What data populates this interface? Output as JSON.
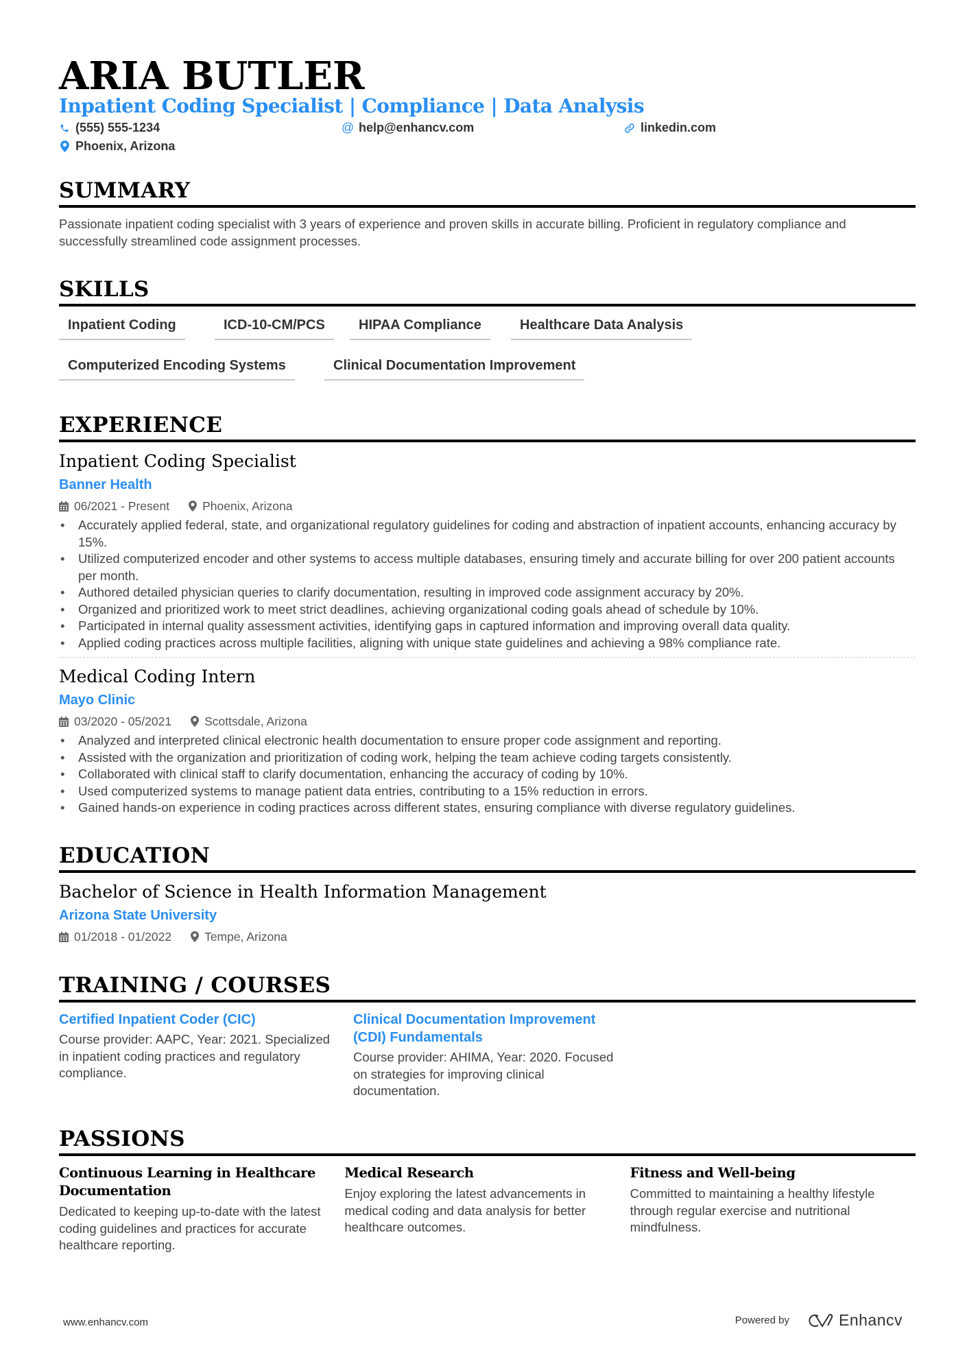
{
  "header": {
    "name": "ARIA BUTLER",
    "headline": "Inpatient Coding Specialist | Compliance | Data Analysis",
    "contacts": {
      "phone": {
        "icon": "phone-icon",
        "value": "(555) 555-1234"
      },
      "email": {
        "icon": "at-icon",
        "value": "help@enhancv.com"
      },
      "website": {
        "icon": "link-icon",
        "value": "linkedin.com"
      },
      "location": {
        "icon": "map-pin-icon",
        "value": "Phoenix, Arizona"
      }
    }
  },
  "summary": {
    "title": "SUMMARY",
    "text": "Passionate inpatient coding specialist with 3 years of experience and proven skills in accurate billing. Proficient in regulatory compliance and successfully streamlined code assignment processes."
  },
  "skills": {
    "title": "SKILLS",
    "items": [
      "Inpatient Coding",
      "ICD-10-CM/PCS",
      "HIPAA Compliance",
      "Healthcare Data Analysis",
      "Computerized Encoding Systems",
      "Clinical Documentation Improvement"
    ]
  },
  "experience": {
    "title": "EXPERIENCE",
    "items": [
      {
        "role": "Inpatient Coding Specialist",
        "company": "Banner Health",
        "dates": "06/2021 - Present",
        "location": "Phoenix, Arizona",
        "bullets": [
          "Accurately applied federal, state, and organizational regulatory guidelines for coding and abstraction of inpatient accounts, enhancing accuracy by 15%.",
          "Utilized computerized encoder and other systems to access multiple databases, ensuring timely and accurate billing for over 200 patient accounts per month.",
          "Authored detailed physician queries to clarify documentation, resulting in improved code assignment accuracy by 20%.",
          "Organized and prioritized work to meet strict deadlines, achieving organizational coding goals ahead of schedule by 10%.",
          "Participated in internal quality assessment activities, identifying gaps in captured information and improving overall data quality.",
          "Applied coding practices across multiple facilities, aligning with unique state guidelines and achieving a 98% compliance rate."
        ]
      },
      {
        "role": "Medical Coding Intern",
        "company": "Mayo Clinic",
        "dates": "03/2020 - 05/2021",
        "location": "Scottsdale, Arizona",
        "bullets": [
          "Analyzed and interpreted clinical electronic health documentation to ensure proper code assignment and reporting.",
          "Assisted with the organization and prioritization of coding work, helping the team achieve coding targets consistently.",
          "Collaborated with clinical staff to clarify documentation, enhancing the accuracy of coding by 10%.",
          "Used computerized systems to manage patient data entries, contributing to a 15% reduction in errors.",
          "Gained hands-on experience in coding practices across different states, ensuring compliance with diverse regulatory guidelines."
        ]
      }
    ]
  },
  "education": {
    "title": "EDUCATION",
    "items": [
      {
        "degree": "Bachelor of Science in Health Information Management",
        "school": "Arizona State University",
        "dates": "01/2018 - 01/2022",
        "location": "Tempe, Arizona"
      }
    ]
  },
  "training": {
    "title": "TRAINING / COURSES",
    "items": [
      {
        "title": "Certified Inpatient Coder (CIC)",
        "text": "Course provider: AAPC, Year: 2021. Specialized in inpatient coding practices and regulatory compliance."
      },
      {
        "title": "Clinical Documentation Improvement (CDI) Fundamentals",
        "text": "Course provider: AHIMA, Year: 2020. Focused on strategies for improving clinical documentation."
      }
    ]
  },
  "passions": {
    "title": "PASSIONS",
    "items": [
      {
        "title": "Continuous Learning in Healthcare Documentation",
        "text": "Dedicated to keeping up-to-date with the latest coding guidelines and practices for accurate healthcare reporting."
      },
      {
        "title": "Medical Research",
        "text": "Enjoy exploring the latest advancements in medical coding and data analysis for better healthcare outcomes."
      },
      {
        "title": "Fitness and Well-being",
        "text": "Committed to maintaining a healthy lifestyle through regular exercise and nutritional mindfulness."
      }
    ]
  },
  "footer": {
    "website": "www.enhancv.com",
    "powered_by": "Powered by",
    "brand": "Enhancv"
  },
  "colors": {
    "accent": "#2a8ef0",
    "heading": "#000000",
    "body": "#444444"
  }
}
